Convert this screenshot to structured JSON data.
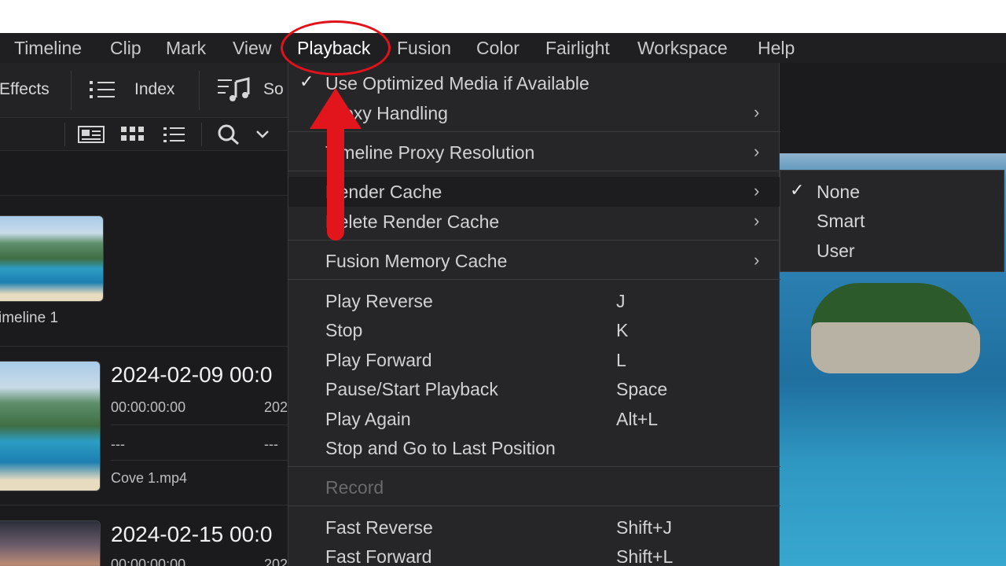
{
  "menubar": {
    "items": [
      "Timeline",
      "Clip",
      "Mark",
      "View",
      "Playback",
      "Fusion",
      "Color",
      "Fairlight",
      "Workspace",
      "Help"
    ],
    "active": "Playback"
  },
  "toolbar": {
    "effects_label": "Effects",
    "index_label": "Index",
    "sound_label": "So"
  },
  "media_pool": {
    "timeline_clip_label": "imeline 1",
    "clip1": {
      "title": "2024-02-09  00:0",
      "timecode": "00:00:00:00",
      "timecode2": "202",
      "dash1": "---",
      "dash2": "---",
      "filename": "Cove 1.mp4"
    },
    "clip2": {
      "title": "2024-02-15  00:0",
      "timecode": "00:00:00:00",
      "timecode2": "202"
    }
  },
  "playback_menu": {
    "items": [
      {
        "label": "Use Optimized Media if Available",
        "checked": true
      },
      {
        "label": "Proxy Handling",
        "submenu": true
      },
      {
        "label": "Timeline Proxy Resolution",
        "submenu": true
      },
      {
        "label": "Render Cache",
        "submenu": true,
        "highlighted": true
      },
      {
        "label": "Delete Render Cache",
        "submenu": true
      },
      {
        "label": "Fusion Memory Cache",
        "submenu": true
      },
      {
        "label": "Play Reverse",
        "shortcut": "J"
      },
      {
        "label": "Stop",
        "shortcut": "K"
      },
      {
        "label": "Play Forward",
        "shortcut": "L"
      },
      {
        "label": "Pause/Start Playback",
        "shortcut": "Space"
      },
      {
        "label": "Play Again",
        "shortcut": "Alt+L"
      },
      {
        "label": "Stop and Go to Last Position"
      },
      {
        "label": "Record",
        "disabled": true
      },
      {
        "label": "Fast Reverse",
        "shortcut": "Shift+J"
      },
      {
        "label": "Fast Forward",
        "shortcut": "Shift+L"
      }
    ]
  },
  "render_cache_submenu": {
    "items": [
      {
        "label": "None",
        "checked": true
      },
      {
        "label": "Smart"
      },
      {
        "label": "User"
      }
    ]
  },
  "icons": {
    "checkmark": "✓",
    "chevron_right": "›",
    "chevron_down": "⌄"
  },
  "colors": {
    "annotation_red": "#e3151c",
    "menu_bg": "#262629",
    "app_bg": "#1b1b1d"
  }
}
